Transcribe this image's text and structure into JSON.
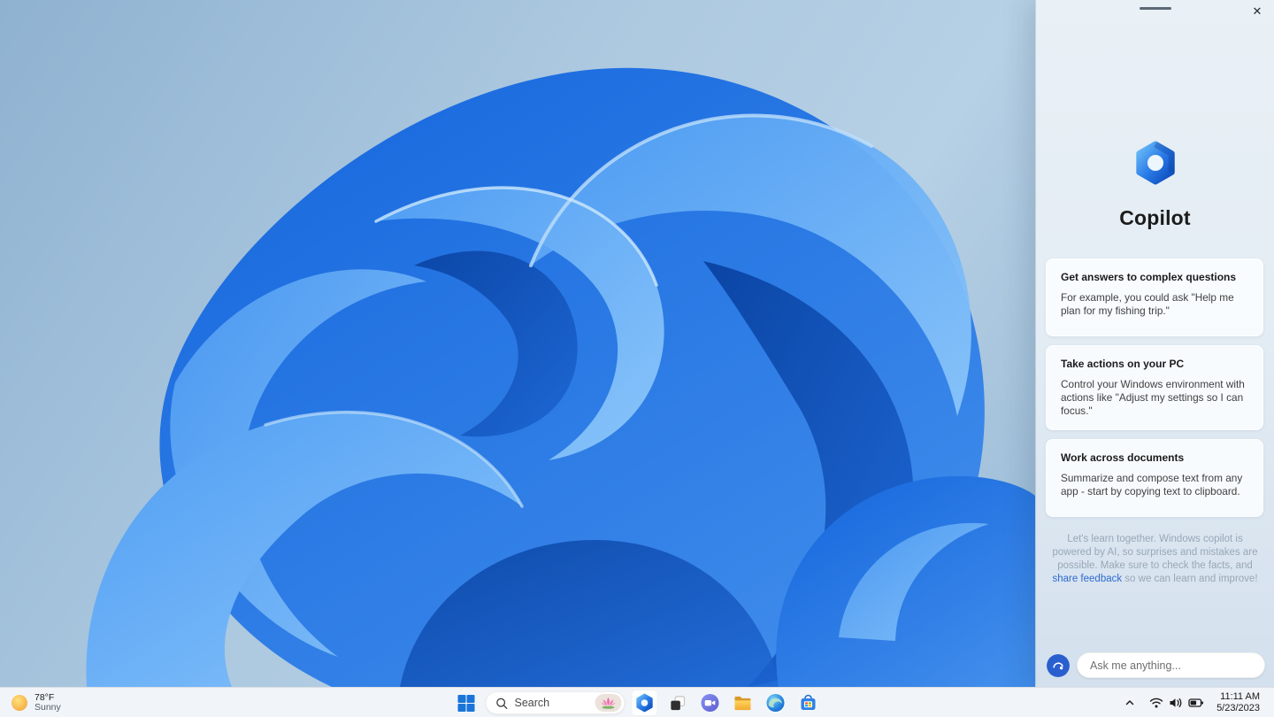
{
  "panel": {
    "close_glyph": "✕",
    "title": "Copilot",
    "cards": [
      {
        "title": "Get answers to complex questions",
        "body": "For example, you could ask \"Help me plan for my fishing trip.\""
      },
      {
        "title": "Take actions on your PC",
        "body": "Control your Windows environment with actions like \"Adjust my settings so I can focus.\""
      },
      {
        "title": "Work across documents",
        "body": "Summarize and compose text from any app - start by copying text to clipboard."
      }
    ],
    "disclaimer": {
      "text_before_link": "Let's learn together. Windows copilot is powered by AI, so surprises and mistakes are possible. Make sure to check the facts, and ",
      "link_label": "share feedback",
      "text_after_link": " so we can learn and improve!"
    },
    "input_placeholder": "Ask me anything..."
  },
  "taskbar": {
    "weather": {
      "temperature": "78°F",
      "condition": "Sunny"
    },
    "search": {
      "label": "Search"
    },
    "clock": {
      "time": "11:11 AM",
      "date": "5/23/2023"
    }
  },
  "colors": {
    "accent_blue": "#1b6ce0",
    "link_blue": "#2f6bd0",
    "copilot_circle": "#2a5fd0"
  }
}
